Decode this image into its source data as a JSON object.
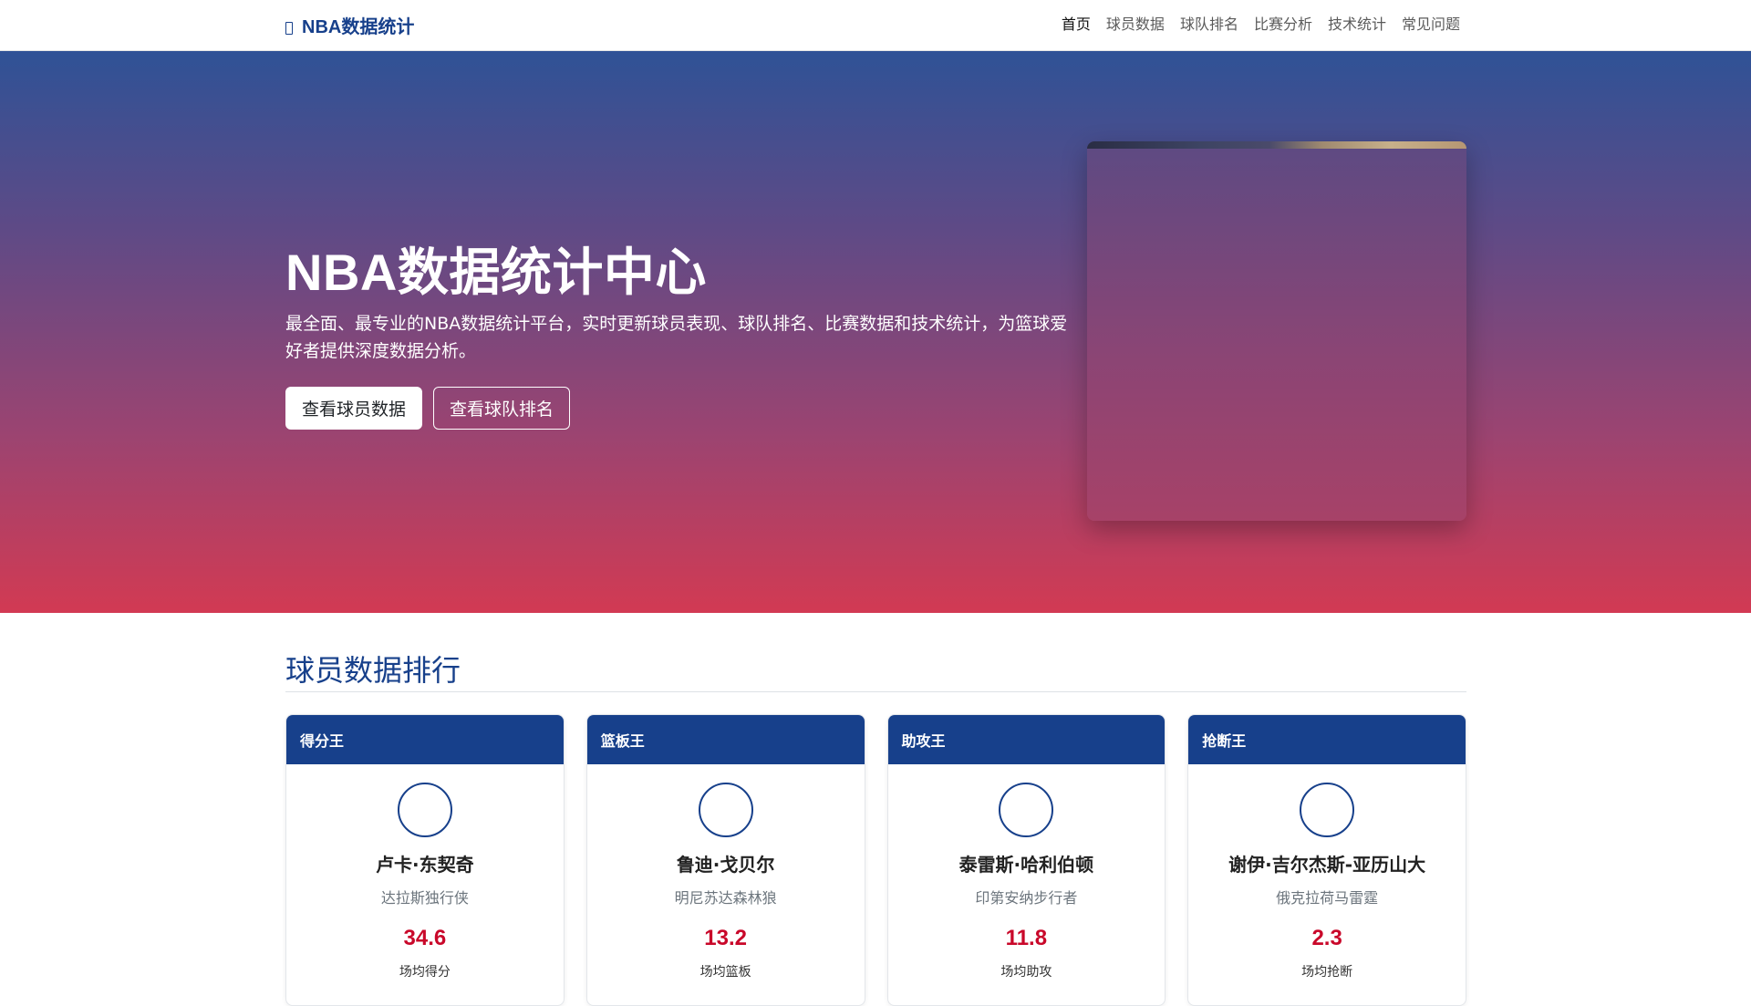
{
  "navbar": {
    "brand": "NBA数据统计",
    "links": [
      "首页",
      "球员数据",
      "球队排名",
      "比赛分析",
      "技术统计",
      "常见问题"
    ]
  },
  "hero": {
    "title": "NBA数据统计中心",
    "description": "最全面、最专业的NBA数据统计平台，实时更新球员表现、球队排名、比赛数据和技术统计，为篮球爱好者提供深度数据分析。",
    "primary_button": "查看球员数据",
    "secondary_button": "查看球队排名"
  },
  "section": {
    "title": "球员数据排行"
  },
  "cards": [
    {
      "header": "得分王",
      "player": "卢卡·东契奇",
      "team": "达拉斯独行侠",
      "value": "34.6",
      "label": "场均得分"
    },
    {
      "header": "篮板王",
      "player": "鲁迪·戈贝尔",
      "team": "明尼苏达森林狼",
      "value": "13.2",
      "label": "场均篮板"
    },
    {
      "header": "助攻王",
      "player": "泰雷斯·哈利伯顿",
      "team": "印第安纳步行者",
      "value": "11.8",
      "label": "场均助攻"
    },
    {
      "header": "抢断王",
      "player": "谢伊·吉尔杰斯-亚历山大",
      "team": "俄克拉荷马雷霆",
      "value": "2.3",
      "label": "场均抢断"
    }
  ],
  "colors": {
    "brand": "#17408b",
    "accent_red": "#c9082a"
  }
}
